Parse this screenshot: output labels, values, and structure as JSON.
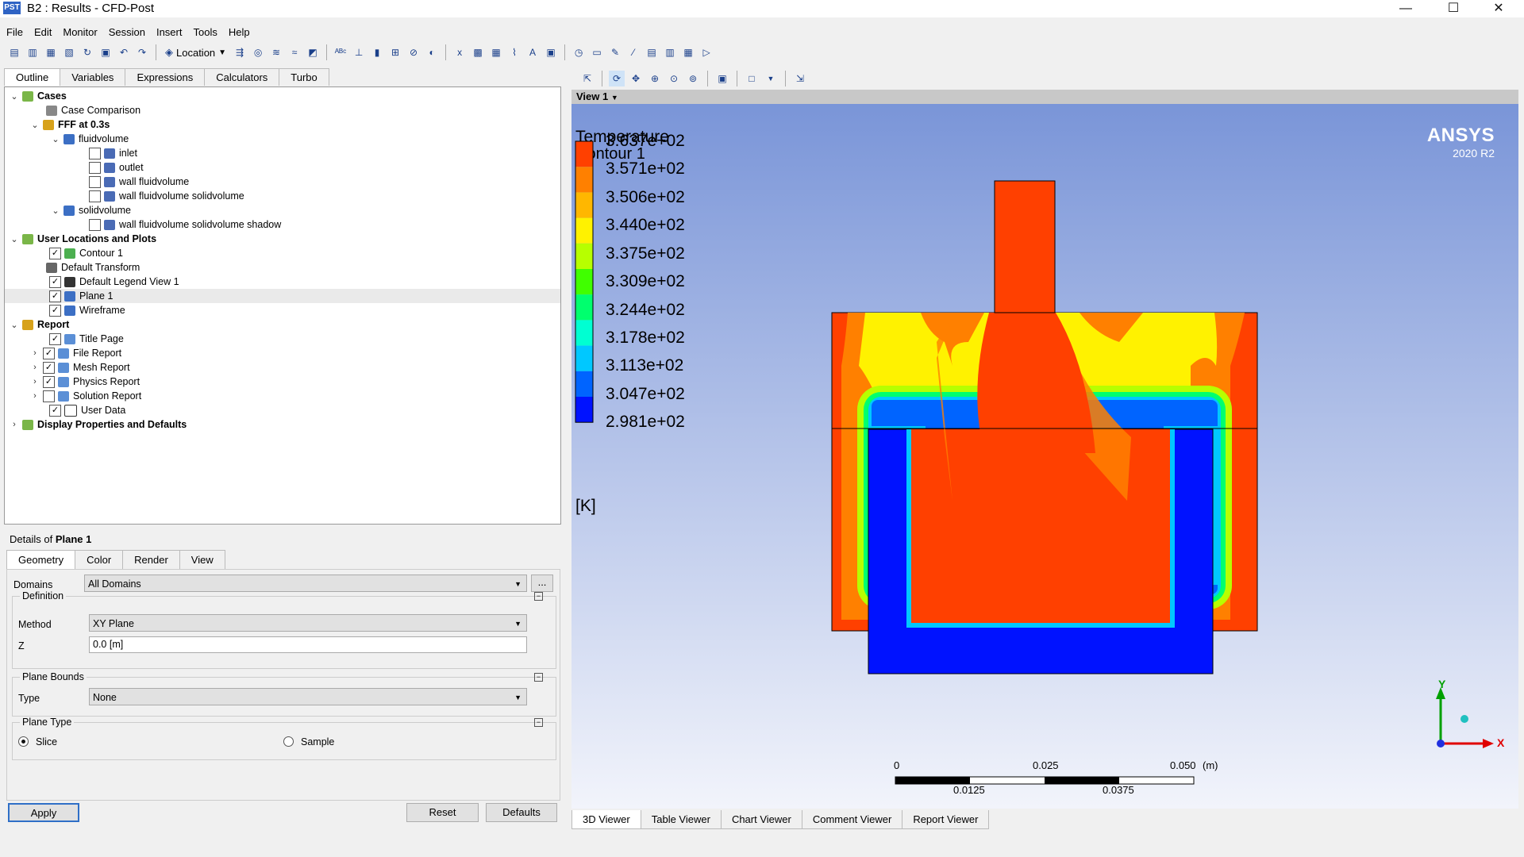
{
  "window": {
    "icon_text": "PST",
    "title": "B2 : Results - CFD-Post",
    "controls": [
      "—",
      "☐",
      "✕"
    ]
  },
  "menu": [
    "File",
    "Edit",
    "Monitor",
    "Session",
    "Insert",
    "Tools",
    "Help"
  ],
  "toolbar": {
    "location_label": "Location"
  },
  "left_tabs": [
    "Outline",
    "Variables",
    "Expressions",
    "Calculators",
    "Turbo"
  ],
  "tree": {
    "cases": "Cases",
    "case_comparison": "Case Comparison",
    "fff": "FFF at 0.3s",
    "fluidvolume": "fluidvolume",
    "inlet": "inlet",
    "outlet": "outlet",
    "wall_fluid": "wall fluidvolume",
    "wall_fluid_solid": "wall fluidvolume solidvolume",
    "solidvolume": "solidvolume",
    "wall_shadow": "wall fluidvolume solidvolume shadow",
    "user_locations": "User Locations and Plots",
    "contour1": "Contour 1",
    "default_transform": "Default Transform",
    "default_legend": "Default Legend View 1",
    "plane1": "Plane 1",
    "wireframe": "Wireframe",
    "report": "Report",
    "title_page": "Title Page",
    "file_report": "File Report",
    "mesh_report": "Mesh Report",
    "physics_report": "Physics Report",
    "solution_report": "Solution Report",
    "user_data": "User Data",
    "display_props": "Display Properties and Defaults"
  },
  "details": {
    "prefix": "Details of ",
    "object": "Plane 1",
    "tabs": [
      "Geometry",
      "Color",
      "Render",
      "View"
    ],
    "domains_label": "Domains",
    "domains_value": "All Domains",
    "ellipsis": "...",
    "definition": "Definition",
    "method_label": "Method",
    "method_value": "XY Plane",
    "z_label": "Z",
    "z_value": "0.0 [m]",
    "plane_bounds": "Plane Bounds",
    "type_label": "Type",
    "type_value": "None",
    "plane_type": "Plane Type",
    "slice": "Slice",
    "sample": "Sample",
    "apply": "Apply",
    "reset": "Reset",
    "defaults": "Defaults"
  },
  "viewer": {
    "view_name": "View 1",
    "legend_title": "Temperature",
    "legend_subtitle": "Contour 1",
    "unit": "[K]",
    "legend_values": [
      "3.637e+02",
      "3.571e+02",
      "3.506e+02",
      "3.440e+02",
      "3.375e+02",
      "3.309e+02",
      "3.244e+02",
      "3.178e+02",
      "3.113e+02",
      "3.047e+02",
      "2.981e+02"
    ],
    "legend_colors": [
      "#ff4000",
      "#ff8000",
      "#ffb700",
      "#fff200",
      "#b7ff00",
      "#40ff00",
      "#00ff6e",
      "#00ffd2",
      "#00c8ff",
      "#0064ff",
      "#0012ff"
    ],
    "brand": "ANSYS",
    "version": "2020 R2",
    "scale_top": [
      "0",
      "0.025",
      "0.050",
      "(m)"
    ],
    "scale_bottom": [
      "0.0125",
      "0.0375"
    ],
    "axis_y": "Y",
    "axis_x": "X"
  },
  "bottom_tabs": [
    "3D Viewer",
    "Table Viewer",
    "Chart Viewer",
    "Comment Viewer",
    "Report Viewer"
  ]
}
